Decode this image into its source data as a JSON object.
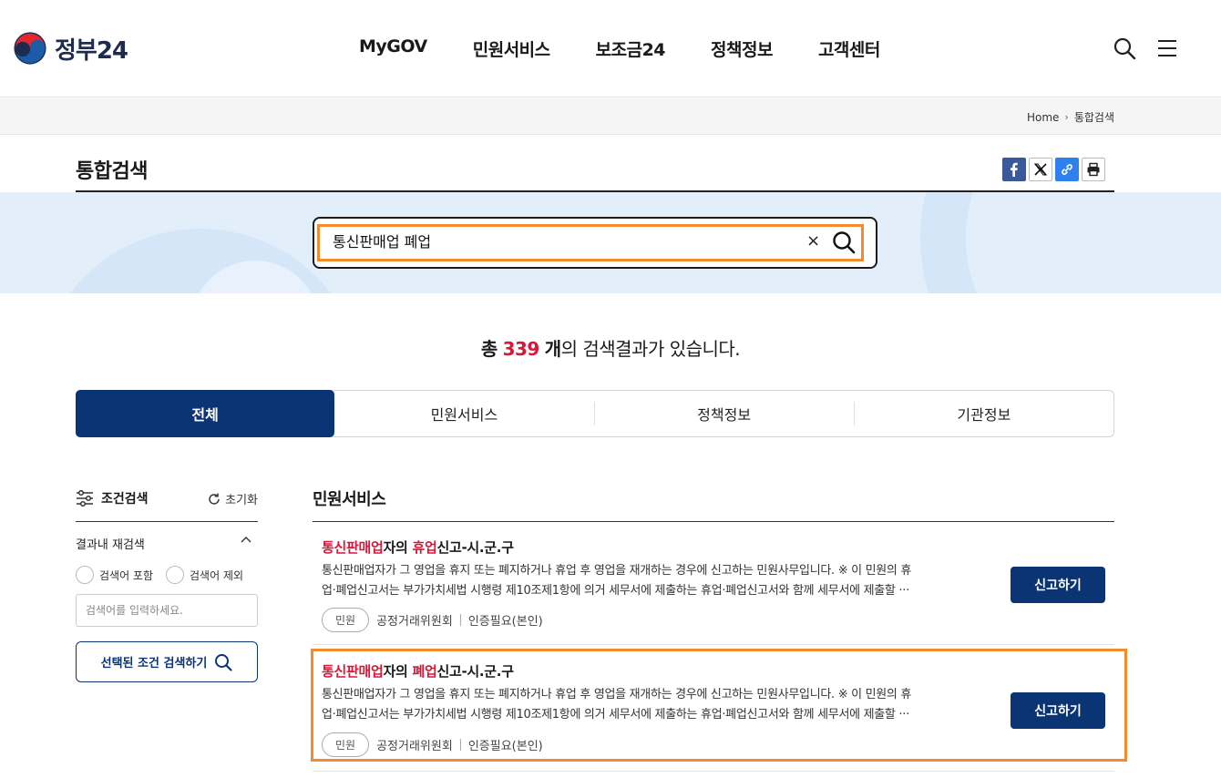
{
  "header": {
    "logo_text": "정부24",
    "nav": [
      "MyGOV",
      "민원서비스",
      "보조금24",
      "정책정보",
      "고객센터"
    ]
  },
  "breadcrumb": {
    "home": "Home",
    "current": "통합검색"
  },
  "page_title": "통합검색",
  "search": {
    "value": "통신판매업 폐업",
    "clear_label": "×"
  },
  "result_count": {
    "prefix": "총",
    "number": "339",
    "unit": "개",
    "suffix": "의 검색결과가 있습니다."
  },
  "tabs": [
    "전체",
    "민원서비스",
    "정책정보",
    "기관정보"
  ],
  "filter": {
    "title": "조건검색",
    "reset_label": "초기화",
    "refine_title": "결과내 재검색",
    "radio_include": "검색어 포함",
    "radio_exclude": "검색어 제외",
    "input_placeholder": "검색어를 입력하세요.",
    "submit_label": "선택된 조건 검색하기"
  },
  "section_title": "민원서비스",
  "results": [
    {
      "title_kw1": "통신판매업",
      "title_mid": "자의 ",
      "title_kw2": "휴업",
      "title_end": "신고-시.군.구",
      "desc_line1": "통신판매업자가 그 영업을 휴지 또는 폐지하거나 휴업 후 영업을 재개하는 경우에 신고하는 민원사무입니다. ※ 이 민원의 휴",
      "desc_line2": "업·폐업신고서는 부가가치세법 시행령 제10조제1항에 의거 세무서에 제출하는 휴업·폐업신고서와 함께 세무서에 제출할 ···",
      "badge": "민원",
      "agency": "공정거래위원회",
      "auth": "인증필요(본인)",
      "button": "신고하기"
    },
    {
      "title_kw1": "통신판매업",
      "title_mid": "자의 ",
      "title_kw2": "폐업",
      "title_end": "신고-시.군.구",
      "desc_line1": "통신판매업자가 그 영업을 휴지 또는 폐지하거나 휴업 후 영업을 재개하는 경우에 신고하는 민원사무입니다. ※ 이 민원의 휴",
      "desc_line2": "업·폐업신고서는 부가가치세법 시행령 제10조제1항에 의거 세무서에 제출하는 휴업·폐업신고서와 함께 세무서에 제출할 ···",
      "badge": "민원",
      "agency": "공정거래위원회",
      "auth": "인증필요(본인)",
      "button": "신고하기"
    }
  ],
  "colors": {
    "primary": "#0b3475",
    "highlight": "#f28a2e",
    "keyword_red": "#d9173a",
    "band": "#e3eefb"
  },
  "icons": [
    "gov-logo-icon",
    "search-icon",
    "hamburger-menu-icon",
    "facebook-icon",
    "x-icon",
    "link-icon",
    "print-icon",
    "clear-icon",
    "filter-icon",
    "refresh-icon",
    "chevron-up-icon"
  ]
}
